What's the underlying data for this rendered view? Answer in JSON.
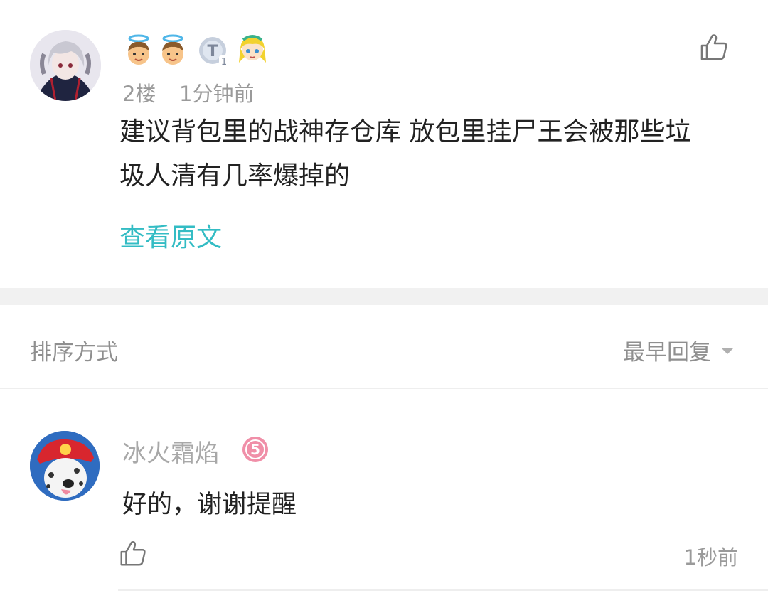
{
  "comment": {
    "floor": "2楼",
    "time": "1分钟前",
    "text_line1": "建议背包里的战神存仓库 放包里挂尸王会被那些垃",
    "text_line2": "圾人清有几率爆掉的",
    "view_original": "查看原文",
    "badges": [
      "angel-badge-icon",
      "angel-badge-icon",
      "t1-title-badge-icon",
      "anime-character-badge-icon"
    ]
  },
  "sort": {
    "label": "排序方式",
    "selected": "最早回复"
  },
  "replies": [
    {
      "username": "冰火霜焰",
      "level": "5",
      "text": "好的，谢谢提醒",
      "time": "1秒前"
    }
  ],
  "colors": {
    "link": "#33bcc4",
    "level_badge": "#f08fa8",
    "separator": "#f1f1f1"
  }
}
